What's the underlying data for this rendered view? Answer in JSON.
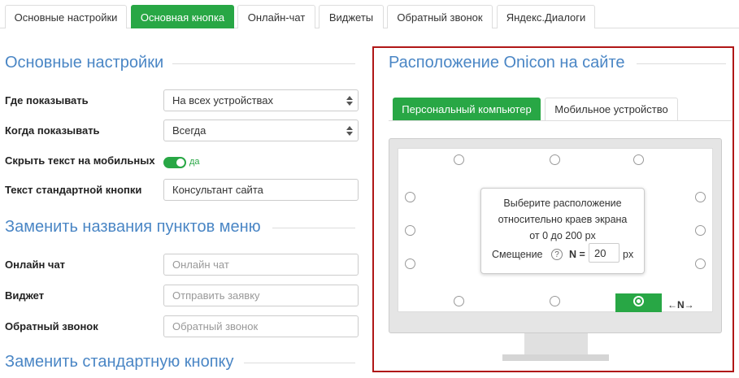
{
  "tabs": [
    "Основные настройки",
    "Основная кнопка",
    "Онлайн-чат",
    "Виджеты",
    "Обратный звонок",
    "Яндекс.Диалоги"
  ],
  "colors": {
    "accent": "#28a745",
    "title": "#4a86c5",
    "panel_border": "#b01717"
  },
  "basic": {
    "title": "Основные настройки",
    "where_label": "Где показывать",
    "where_value": "На всех устройствах",
    "when_label": "Когда показывать",
    "when_value": "Всегда",
    "hide_label": "Скрыть текст на мобильных",
    "hide_value": "да",
    "button_text_label": "Текст стандартной кнопки",
    "button_text_value": "Консультант сайта"
  },
  "rename": {
    "title": "Заменить названия пунктов меню",
    "chat_label": "Онлайн чат",
    "chat_placeholder": "Онлайн чат",
    "widget_label": "Виджет",
    "widget_placeholder": "Отправить заявку",
    "callback_label": "Обратный звонок",
    "callback_placeholder": "Обратный звонок"
  },
  "replace": {
    "title": "Заменить стандартную кнопку"
  },
  "placement": {
    "title": "Расположение Onicon на сайте",
    "tab_desktop": "Персональный компьютер",
    "tab_mobile": "Мобильное устройство",
    "tip_line1": "Выберите расположение",
    "tip_line2": "относительно краев экрана",
    "tip_line3": "от 0 до 200 px",
    "offset_label": "Смещение",
    "help_symbol": "?",
    "n_label": "N =",
    "offset_value": "20",
    "unit": "px",
    "n_arrow": "N"
  }
}
